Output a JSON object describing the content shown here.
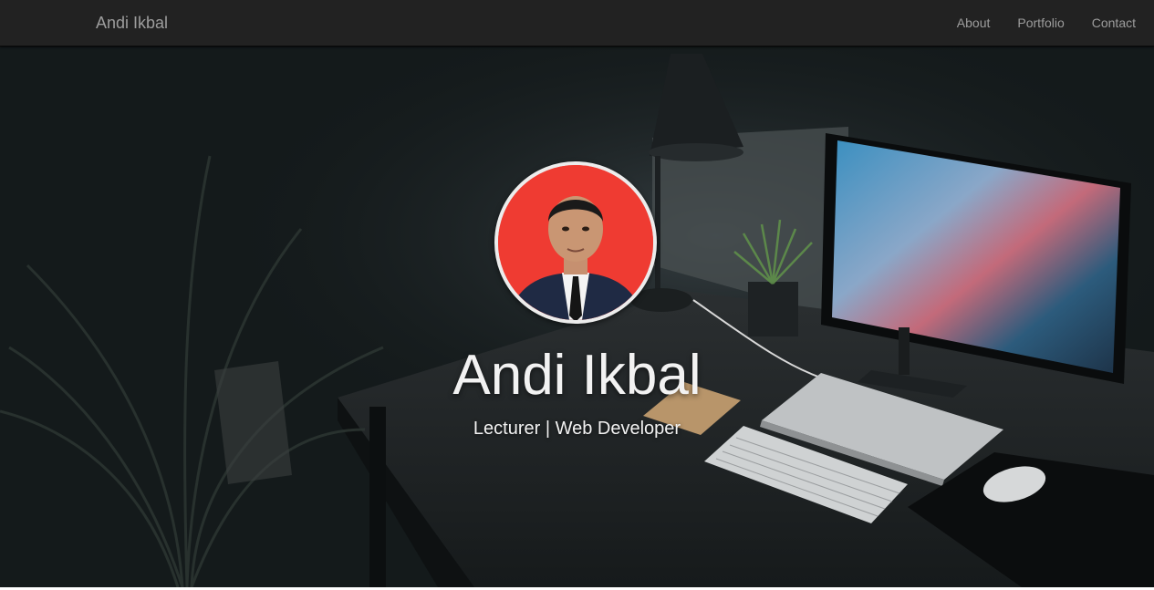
{
  "navbar": {
    "brand": "Andi Ikbal",
    "links": [
      {
        "label": "About"
      },
      {
        "label": "Portfolio"
      },
      {
        "label": "Contact"
      }
    ]
  },
  "hero": {
    "name": "Andi Ikbal",
    "tagline": "Lecturer | Web Developer",
    "photo_icon": "profile-photo"
  },
  "colors": {
    "navbar_bg": "#222222",
    "navbar_text": "#9d9d9d",
    "hero_text": "#f2f2f2",
    "photo_bg": "#ef3b32"
  }
}
